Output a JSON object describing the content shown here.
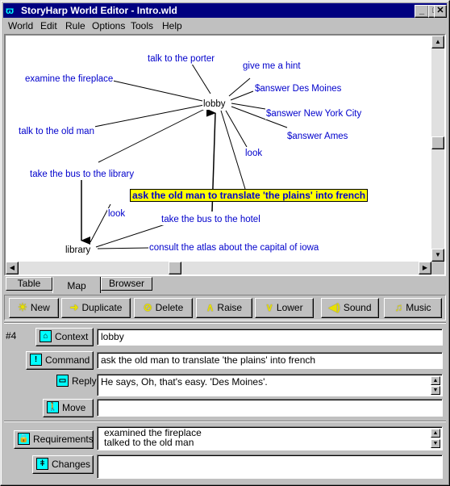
{
  "window": {
    "title": "StoryHarp World Editor - Intro.wld",
    "controls": {
      "minimize": "_",
      "maximize": "□",
      "close": "✕"
    }
  },
  "menu": [
    "World",
    "Edit",
    "Rule",
    "Options",
    "Tools",
    "Help"
  ],
  "map": {
    "contexts": [
      {
        "id": "lobby",
        "label": "lobby"
      },
      {
        "id": "library",
        "label": "library"
      }
    ],
    "commands": [
      {
        "id": "talk_porter",
        "label": "talk to the porter",
        "context": "lobby"
      },
      {
        "id": "hint",
        "label": "give me a hint",
        "context": "lobby"
      },
      {
        "id": "fireplace",
        "label": "examine the fireplace",
        "context": "lobby"
      },
      {
        "id": "ans_dm",
        "label": "$answer Des Moines",
        "context": "lobby"
      },
      {
        "id": "ans_nyc",
        "label": "$answer New York City",
        "context": "lobby"
      },
      {
        "id": "ans_ames",
        "label": "$answer Ames",
        "context": "lobby"
      },
      {
        "id": "old_man",
        "label": "talk to the old man",
        "context": "lobby"
      },
      {
        "id": "look_lobby",
        "label": "look",
        "context": "lobby"
      },
      {
        "id": "bus_library",
        "label": "take the bus to the library",
        "context": "lobby",
        "moves_to": "library"
      },
      {
        "id": "translate",
        "label": "ask the old man to translate 'the plains' into french",
        "context": "lobby",
        "selected": true
      },
      {
        "id": "look_library",
        "label": "look",
        "context": "library"
      },
      {
        "id": "bus_hotel",
        "label": "take the bus to the hotel",
        "context": "library",
        "moves_to": "lobby"
      },
      {
        "id": "atlas",
        "label": "consult the atlas about the capital of iowa",
        "context": "library"
      }
    ]
  },
  "tabs": [
    {
      "label": "Table",
      "active": false
    },
    {
      "label": "Map",
      "active": true
    },
    {
      "label": "Browser",
      "active": false
    }
  ],
  "toolbar": [
    {
      "id": "new",
      "label": "New",
      "icon": "lightbulb-icon",
      "glyph": "💡"
    },
    {
      "id": "duplicate",
      "label": "Duplicate",
      "icon": "arrow-right-icon",
      "glyph": "➜"
    },
    {
      "id": "delete",
      "label": "Delete",
      "icon": "no-sign-icon",
      "glyph": "⊘"
    },
    {
      "id": "raise",
      "label": "Raise",
      "icon": "chevron-up-icon",
      "glyph": "∧"
    },
    {
      "id": "lower",
      "label": "Lower",
      "icon": "chevron-down-icon",
      "glyph": "∨"
    },
    {
      "id": "sound",
      "label": "Sound",
      "icon": "speaker-icon",
      "glyph": "◀)"
    },
    {
      "id": "music",
      "label": "Music",
      "icon": "music-notes-icon",
      "glyph": "♫"
    }
  ],
  "rule": {
    "number": "#4",
    "context": {
      "label": "Context",
      "value": "lobby"
    },
    "command": {
      "label": "Command",
      "value": "ask the old man to translate 'the plains' into french"
    },
    "reply": {
      "label": "Reply",
      "value": "He says, Oh, that's easy. 'Des Moines'."
    },
    "move": {
      "label": "Move",
      "value": ""
    },
    "requirements": {
      "label": "Requirements",
      "lines": [
        "examined the fireplace",
        "talked to the old man"
      ]
    },
    "changes": {
      "label": "Changes",
      "value": ""
    }
  },
  "colors": {
    "titlebar": "#000080",
    "command_text": "#0000cc",
    "selected_bg": "#ffff00",
    "icon_cyan": "#00ffff",
    "face": "#c0c0c0"
  }
}
